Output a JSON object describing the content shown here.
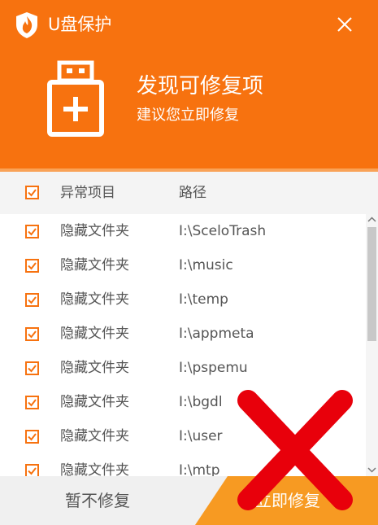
{
  "app": {
    "title": "U盘保护"
  },
  "banner": {
    "heading": "发现可修复项",
    "subheading": "建议您立即修复"
  },
  "columns": {
    "type": "异常项目",
    "path": "路径"
  },
  "select_all_checked": true,
  "rows": [
    {
      "checked": true,
      "type": "隐藏文件夹",
      "path": "I:\\SceloTrash"
    },
    {
      "checked": true,
      "type": "隐藏文件夹",
      "path": "I:\\music"
    },
    {
      "checked": true,
      "type": "隐藏文件夹",
      "path": "I:\\temp"
    },
    {
      "checked": true,
      "type": "隐藏文件夹",
      "path": "I:\\appmeta"
    },
    {
      "checked": true,
      "type": "隐藏文件夹",
      "path": "I:\\pspemu"
    },
    {
      "checked": true,
      "type": "隐藏文件夹",
      "path": "I:\\bgdl"
    },
    {
      "checked": true,
      "type": "隐藏文件夹",
      "path": "I:\\user"
    },
    {
      "checked": true,
      "type": "隐藏文件夹",
      "path": "I:\\mtp"
    }
  ],
  "buttons": {
    "later": "暂不修复",
    "fix_now": "立即修复"
  },
  "colors": {
    "accent": "#f7720f",
    "fix_button": "#f79a22",
    "overlay_x": "#e8000b"
  },
  "icons": {
    "logo": "shield-flame-icon",
    "close": "close-icon",
    "usb": "usb-drive-plus-icon",
    "overlay": "red-x-cross-icon"
  }
}
